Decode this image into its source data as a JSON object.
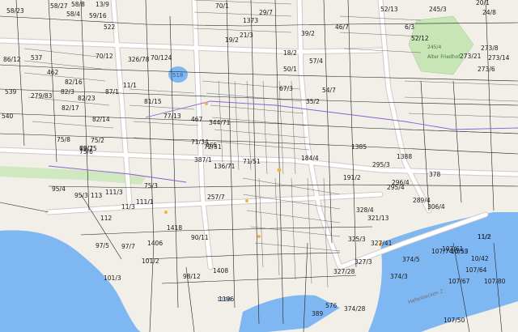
{
  "map": {
    "colors": {
      "background": "#f2efe9",
      "water": "#7fb7f2",
      "road": "#ffffff",
      "road_casing": "#cfcac3",
      "green": "#c8e5b6",
      "parcel_line": "#222222",
      "purple_line": "#8b5fcf",
      "lake": "#7fb7f2"
    },
    "water_labels": [
      "518",
      "1196",
      "11/2",
      "10/53"
    ],
    "street_labels": [
      "Hafenbecken 2",
      "Alter Friedhof"
    ],
    "green_labels": [
      "245/4"
    ],
    "parcel_labels": [
      "58/27",
      "58/23",
      "58/4",
      "522",
      "52/12",
      "1373",
      "39/2",
      "52/13",
      "86/12",
      "537",
      "462",
      "539",
      "279/83",
      "540",
      "82/17",
      "81/15",
      "82/14",
      "77/13",
      "467",
      "344/71",
      "35/2",
      "57/4",
      "50/1",
      "465",
      "72/51",
      "71/34",
      "19/2",
      "1385",
      "1388",
      "378",
      "184/4",
      "191/2",
      "295/3",
      "296/4",
      "289/4",
      "306/4",
      "112",
      "97/5",
      "1406",
      "101/2",
      "101/3",
      "1418",
      "98/12",
      "90/11",
      "257/7",
      "1196",
      "1408",
      "321/13",
      "327/41",
      "325/3",
      "374/5",
      "374/28",
      "389",
      "576",
      "107/61",
      "107/67",
      "107/64",
      "107/80",
      "10/42",
      "11/2",
      "10/53",
      "97/7",
      "95/4",
      "95/3",
      "113",
      "111/3",
      "111/1",
      "75/3",
      "75/8",
      "75/2",
      "75/6",
      "75/25",
      "69/7",
      "136/71",
      "71/51",
      "387/1",
      "11/3",
      "82/3",
      "82/23",
      "70/12",
      "326/78",
      "70/124",
      "58/8",
      "59/16",
      "13/9",
      "70/1",
      "29/7",
      "21/3",
      "273/8",
      "273/21",
      "273/6",
      "273/14",
      "6/3",
      "20/1",
      "24/8",
      "87/1",
      "82/16",
      "11/1",
      "245/3",
      "295/4",
      "54/7",
      "46/7",
      "67/3",
      "18/2",
      "328/4",
      "107/74",
      "327/3",
      "327/28",
      "374/3",
      "107/50"
    ]
  }
}
